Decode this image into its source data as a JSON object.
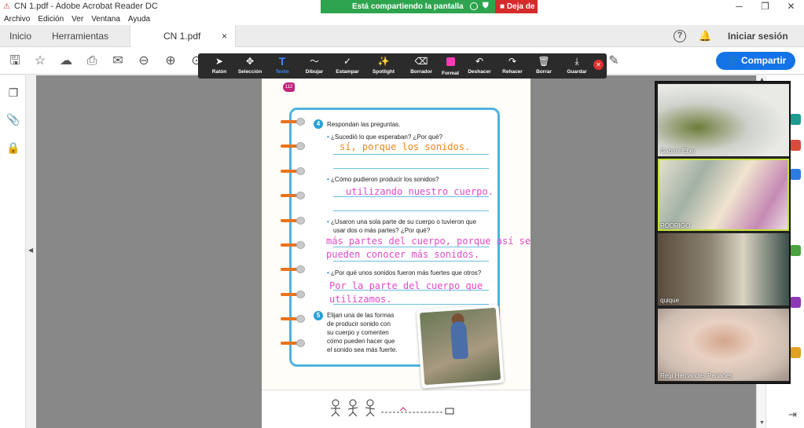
{
  "window": {
    "title": "CN 1.pdf - Adobe Acrobat Reader DC",
    "minimize": "─",
    "maximize": "❐",
    "close": "✕"
  },
  "share_banner": {
    "text": "Está compartiendo la pantalla",
    "stop_label": "Deja de",
    "color": "#2fa44f",
    "stop_color": "#d62b2b"
  },
  "menu": [
    "Archivo",
    "Edición",
    "Ver",
    "Ventana",
    "Ayuda"
  ],
  "tabs": {
    "home": "Inicio",
    "tools": "Herramientas",
    "document": "CN 1.pdf",
    "close": "×"
  },
  "header_right": {
    "help": "?",
    "login": "Iniciar sesión"
  },
  "toolbar": {
    "share_label": "Compartir",
    "accent": "#1473e6"
  },
  "annotation_toolbar": {
    "items": [
      {
        "label": "Ratón",
        "icon": "cursor-icon",
        "glyph": "➤"
      },
      {
        "label": "Selección",
        "icon": "move-icon",
        "glyph": "✥"
      },
      {
        "label": "Texto",
        "icon": "text-icon",
        "glyph": "T",
        "active": true
      },
      {
        "label": "Dibujar",
        "icon": "draw-icon",
        "glyph": "〜"
      },
      {
        "label": "Estampar",
        "icon": "stamp-icon",
        "glyph": "✓"
      },
      {
        "label": "Spotlight",
        "icon": "spotlight-icon",
        "glyph": "✨"
      },
      {
        "label": "Borrador",
        "icon": "eraser-icon",
        "glyph": "⌫"
      },
      {
        "label": "Format",
        "icon": "format-icon",
        "glyph": ""
      },
      {
        "label": "Deshacer",
        "icon": "undo-icon",
        "glyph": "↶"
      },
      {
        "label": "Rehacer",
        "icon": "redo-icon",
        "glyph": "↷"
      },
      {
        "label": "Borrar",
        "icon": "trash-icon",
        "glyph": "🗑"
      },
      {
        "label": "Guardar",
        "icon": "save-icon",
        "glyph": "⤓"
      }
    ],
    "format_color": "#ff3ab8"
  },
  "page": {
    "number": "112",
    "q4_number": "4",
    "q4_intro": "Respondan las preguntas.",
    "q4a": "¿Sucedió lo que esperaban? ¿Por qué?",
    "q4b": "¿Cómo pudieron producir los sonidos?",
    "q4c_1": "¿Usaron una sola parte de su cuerpo o tuvieron que",
    "q4c_2": "usar dos o más partes? ¿Por qué?",
    "q4d": "¿Por qué unos sonidos fueron más fuertes que otros?",
    "q5_number": "5",
    "q5_lines": [
      "Elijan una de las formas",
      "de producir sonido con",
      "su cuerpo y comenten",
      "cómo pueden hacer que",
      "el sonido sea más fuerte."
    ]
  },
  "answers": {
    "a1": "sí, porque los sonidos.",
    "a2": "utilizando nuestro cuerpo.",
    "a3_1": "más partes del cuerpo, porque así se",
    "a3_2": "pueden conocer más sonidos.",
    "a4_1": "Por la parte del cuerpo que",
    "a4_2": "utilizamos."
  },
  "participants": [
    {
      "name": "Gabriel Eber",
      "speaking": false
    },
    {
      "name": "RODRIGO",
      "speaking": true
    },
    {
      "name": "quique",
      "speaking": false
    },
    {
      "name": "Regi Hernandes Periañes",
      "speaking": false
    }
  ]
}
